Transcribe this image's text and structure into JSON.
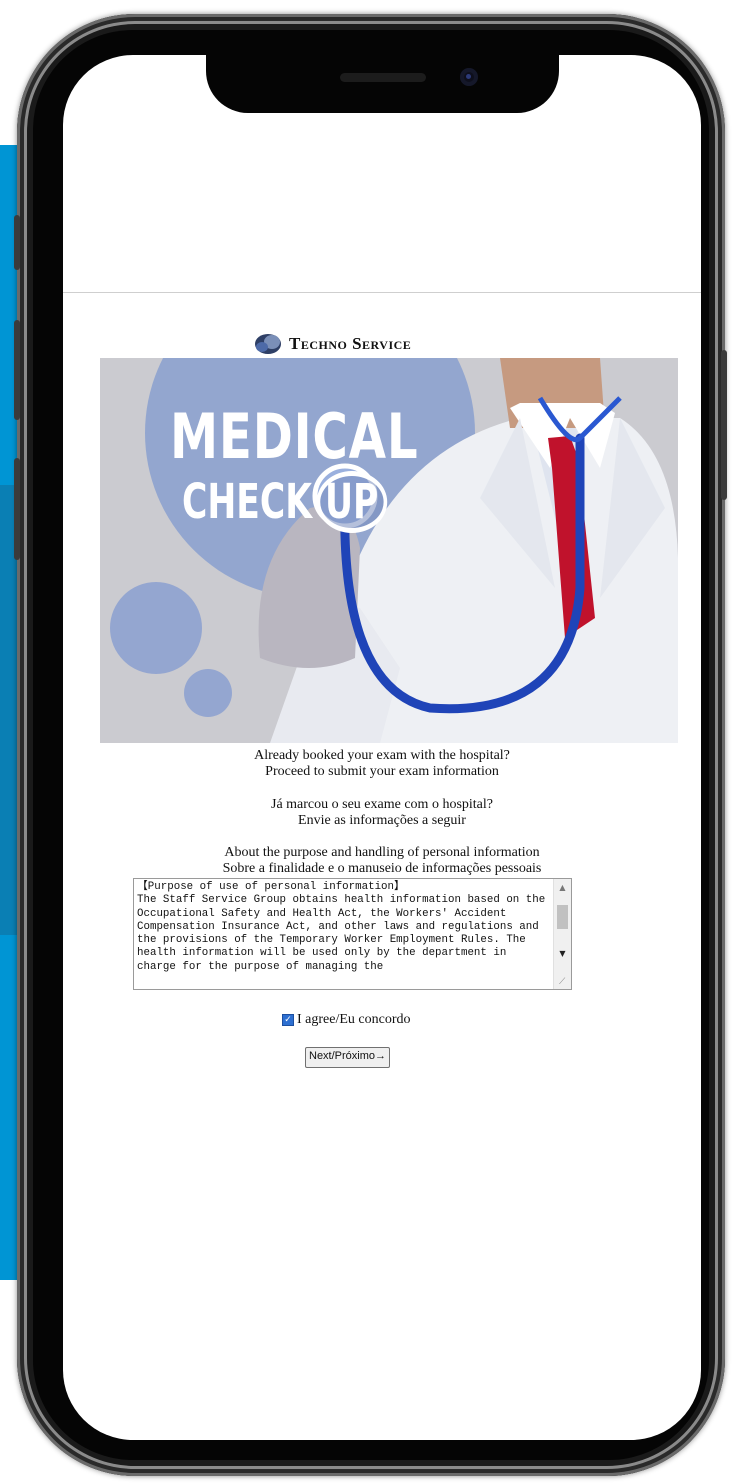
{
  "brand": {
    "name": "Techno Service"
  },
  "hero": {
    "title": "MEDICAL",
    "subtitle_check": "CHECK",
    "subtitle_up": "UP"
  },
  "intro": {
    "en_line1": "Already booked your exam with the hospital?",
    "en_line2": "Proceed to submit your exam information",
    "pt_line1": "Já marcou o seu exame com o hospital?",
    "pt_line2": "Envie as informações a seguir"
  },
  "purpose": {
    "heading_en": "About the purpose and handling of personal information",
    "heading_pt": "Sobre a finalidade e o manuseio de informações pessoais"
  },
  "consent": {
    "text": "【Purpose of use of personal information】\nThe Staff Service Group obtains health information based on the Occupational Safety and Health Act, the Workers' Accident Compensation Insurance Act, and other laws and regulations and the provisions of the Temporary Worker Employment Rules. The health information will be used only by the department in charge for the purpose of managing the"
  },
  "agree": {
    "label": "I agree/Eu concordo",
    "checked": true
  },
  "next_button": {
    "label": "Next/Próximo→"
  },
  "colors": {
    "blue_panel": "#0095d4",
    "blue_panel_dark": "#0a7fb4",
    "hero_circle": "#8aa0cf",
    "stethoscope": "#1f44b8",
    "tie": "#c0122c"
  }
}
